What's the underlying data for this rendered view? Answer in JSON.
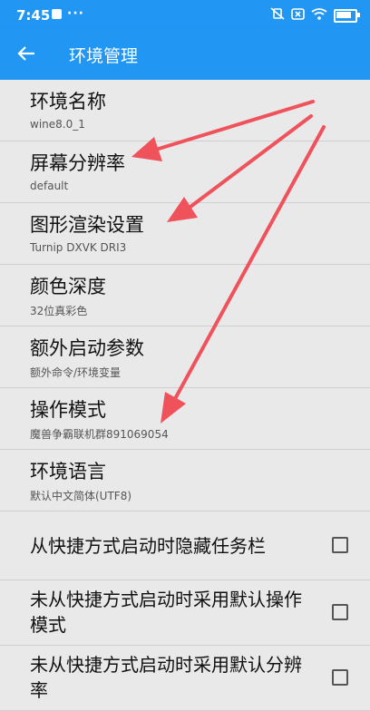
{
  "status_bar": {
    "time": "7:45",
    "notification_dots": "···",
    "battery_level": 0.9
  },
  "app_bar": {
    "title": "环境管理"
  },
  "settings": [
    {
      "title": "环境名称",
      "subtitle": "wine8.0_1"
    },
    {
      "title": "屏幕分辨率",
      "subtitle": "default"
    },
    {
      "title": "图形渲染设置",
      "subtitle": "Turnip DXVK DRI3"
    },
    {
      "title": "颜色深度",
      "subtitle": "32位真彩色"
    },
    {
      "title": "额外启动参数",
      "subtitle": "额外命令/环境变量"
    },
    {
      "title": "操作模式",
      "subtitle": "魔兽争霸联机群891069054"
    },
    {
      "title": "环境语言",
      "subtitle": "默认中文简体(UTF8)"
    }
  ],
  "checkboxes": [
    {
      "label": "从快捷方式启动时隐藏任务栏",
      "checked": false
    },
    {
      "label": "未从快捷方式启动时采用默认操作模式",
      "checked": false
    },
    {
      "label": "未从快捷方式启动时采用默认分辨率",
      "checked": false
    }
  ],
  "colors": {
    "accent": "#2196f3",
    "background": "#e9e9e9",
    "annotation_arrow": "#f0525c"
  }
}
